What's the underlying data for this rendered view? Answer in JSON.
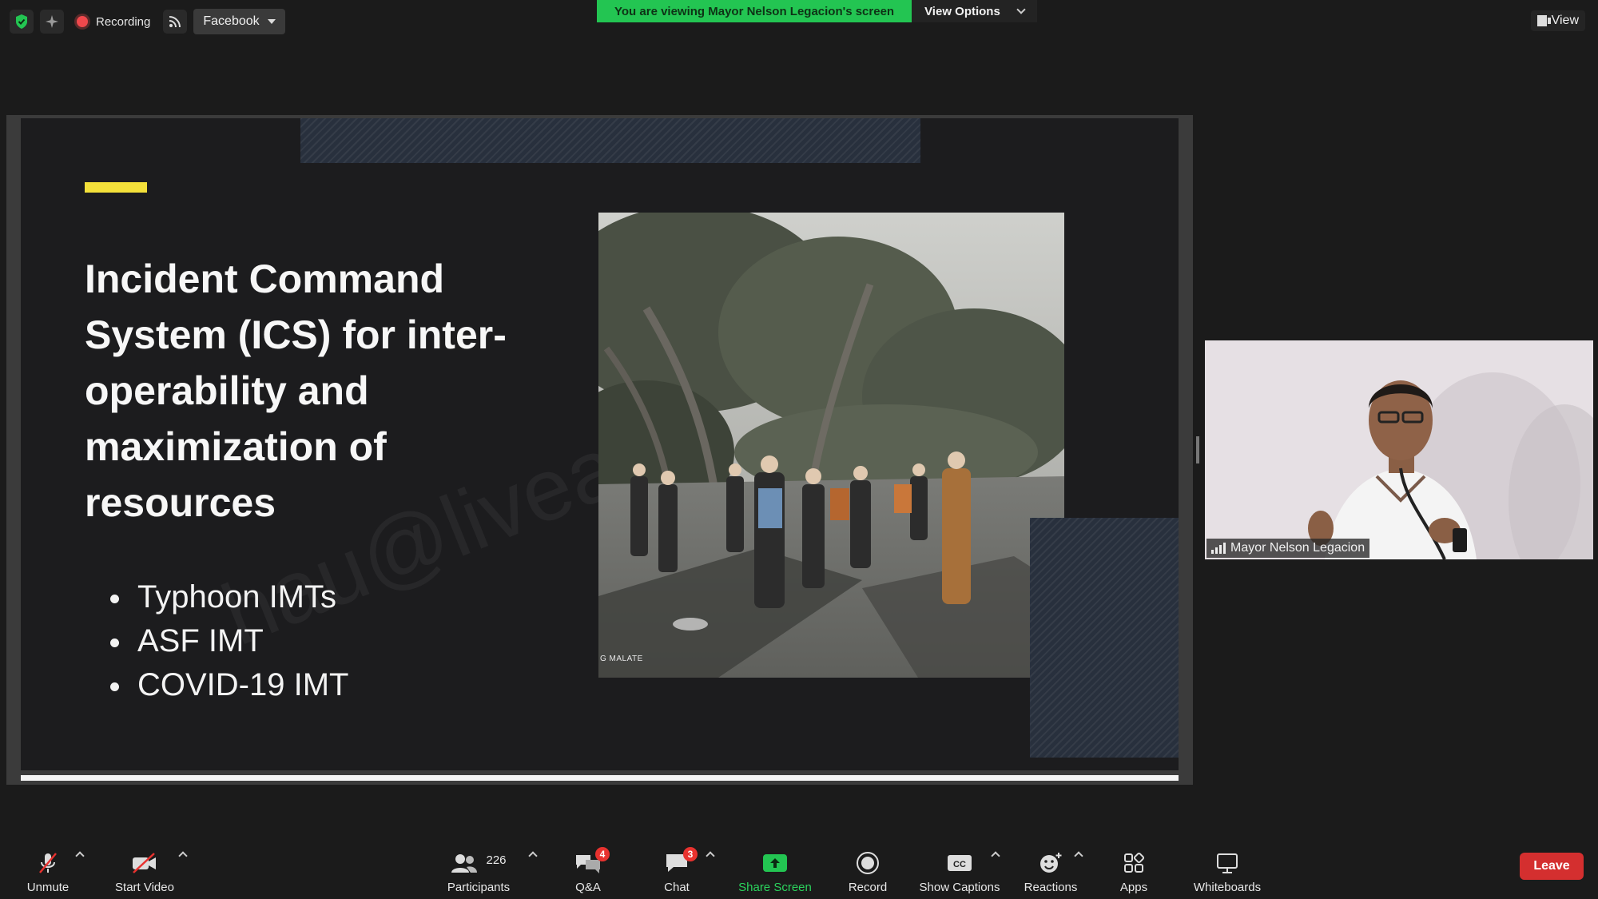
{
  "topbar": {
    "security_icon": "shield-check-icon",
    "ai_icon": "sparkle-icon",
    "recording_label": "Recording",
    "live_icon": "rss-icon",
    "stream_target": "Facebook"
  },
  "banner": {
    "viewing_text": "You are viewing Mayor Nelson Legacion's screen",
    "view_options_label": "View Options"
  },
  "view_button": {
    "label": "View"
  },
  "slide": {
    "title": "Incident Command System (ICS) for inter-operability and maximization of resources",
    "bullets": [
      "Typhoon IMTs",
      "ASF IMT",
      "COVID-19 IMT"
    ],
    "photo_credit": "G MALATE",
    "watermark": "hau@livea"
  },
  "video": {
    "participant_name": "Mayor Nelson Legacion"
  },
  "toolbar": {
    "unmute": "Unmute",
    "start_video": "Start Video",
    "participants": "Participants",
    "participant_count": "226",
    "qa": "Q&A",
    "qa_badge": "4",
    "chat": "Chat",
    "chat_badge": "3",
    "share_screen": "Share Screen",
    "record": "Record",
    "show_captions": "Show Captions",
    "reactions": "Reactions",
    "apps": "Apps",
    "whiteboards": "Whiteboards",
    "leave": "Leave"
  },
  "colors": {
    "share_green": "#23c552",
    "leave_red": "#d42f2f",
    "accent_yellow": "#f3e03a",
    "badge_red": "#e8322f"
  }
}
